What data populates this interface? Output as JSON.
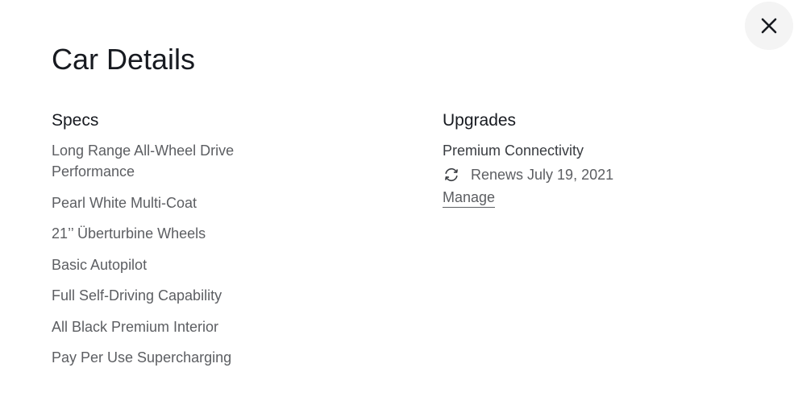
{
  "modal": {
    "title": "Car Details",
    "close_icon": "close-icon"
  },
  "specs": {
    "heading": "Specs",
    "items": [
      "Long Range All-Wheel Drive Performance",
      "Pearl White Multi-Coat",
      "21’’ Überturbine Wheels",
      "Basic Autopilot",
      "Full Self-Driving Capability",
      "All Black Premium Interior",
      "Pay Per Use Supercharging"
    ]
  },
  "upgrades": {
    "heading": "Upgrades",
    "name": "Premium Connectivity",
    "renew_icon": "refresh-icon",
    "renew_text": "Renews July 19, 2021",
    "manage_label": "Manage"
  },
  "colors": {
    "text_primary": "#171a20",
    "text_secondary": "#5c5e62",
    "close_bg": "#f4f4f4"
  }
}
